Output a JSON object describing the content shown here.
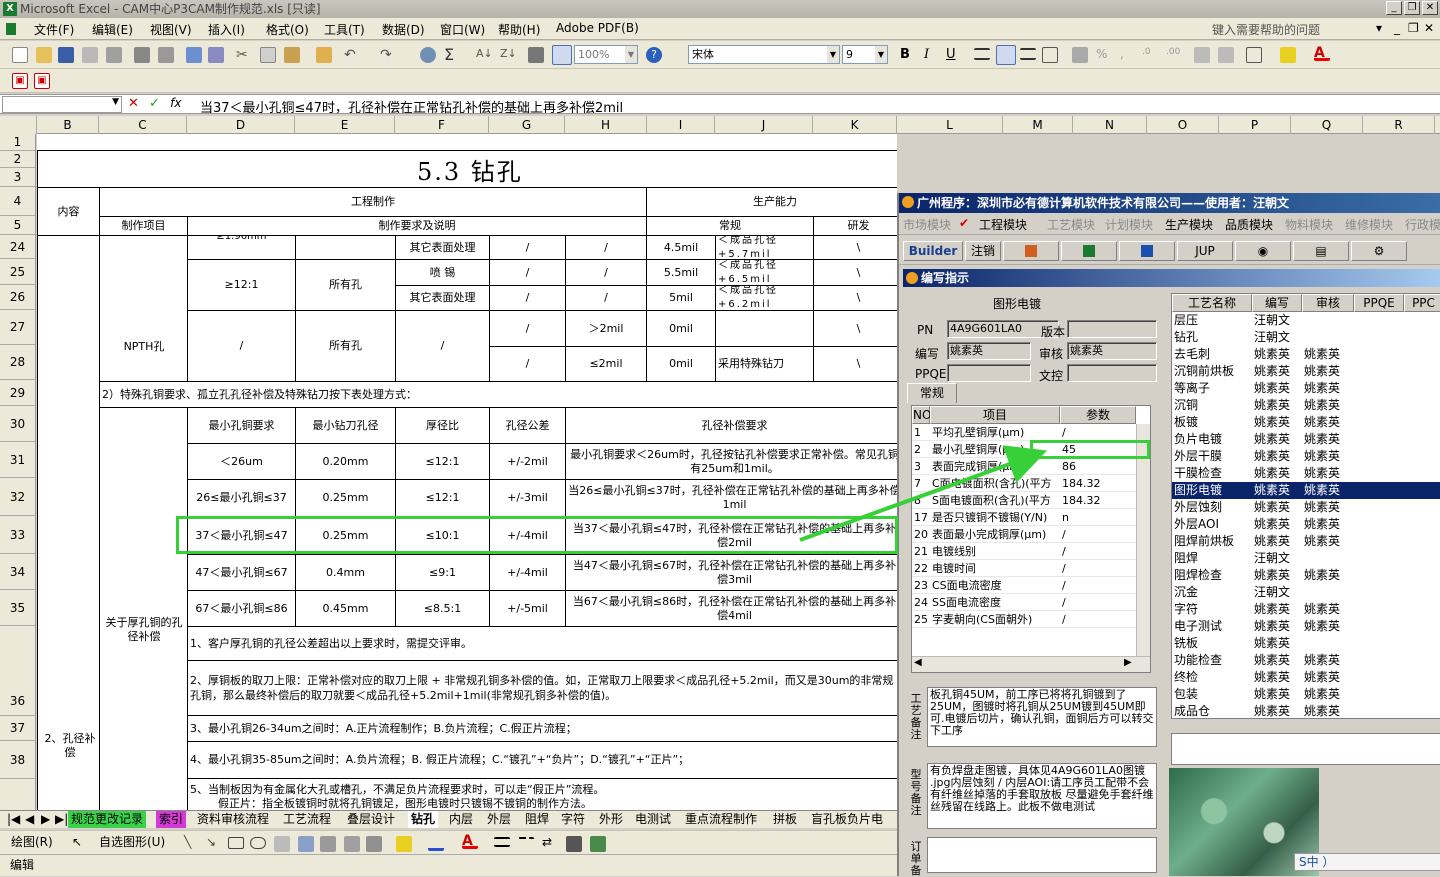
{
  "window": {
    "app_title": "Microsoft Excel - CAM中心P3CAM制作规范.xls [只读]",
    "icon": "excel-icon",
    "help_box": "键入需要帮助的问题"
  },
  "menu": [
    "文件(F)",
    "编辑(E)",
    "视图(V)",
    "插入(I)",
    "格式(O)",
    "工具(T)",
    "数据(D)",
    "窗口(W)",
    "帮助(H)",
    "Adobe PDF(B)"
  ],
  "toolbar": {
    "zoom": "100%",
    "font_name": "宋体",
    "font_size": "9",
    "bold": "B",
    "italic": "I",
    "underline": "U"
  },
  "formula_bar": {
    "name_box": "",
    "fx": "fx",
    "content": "当37＜最小孔铜≤47时，孔径补偿在正常钻孔补偿的基础上再多补偿2mil"
  },
  "columns": [
    "B",
    "C",
    "D",
    "E",
    "F",
    "G",
    "H",
    "I",
    "J",
    "K",
    "L",
    "M",
    "N",
    "O",
    "P",
    "Q",
    "R"
  ],
  "rows": [
    "1",
    "2",
    "3",
    "4",
    "5",
    "24",
    "25",
    "26",
    "27",
    "28",
    "29",
    "30",
    "31",
    "32",
    "33",
    "34",
    "35",
    "36",
    "37",
    "38"
  ],
  "sheet": {
    "title": "5.3 钻孔",
    "header": {
      "content": "内容",
      "engineering": "工程制作",
      "capability": "生产能力",
      "item": "制作项目",
      "requirement": "制作要求及说明",
      "normal": "常规",
      "rnd": "研发"
    },
    "top_rows": [
      {
        "ratio": "",
        "finish": "其它表面处理",
        "g": "/",
        "h": "/",
        "normal": "4.5mil",
        "req": "＜成品孔径+5.7mil",
        "rnd": "\\"
      },
      {
        "ratio": "≥12:1",
        "hole": "所有孔",
        "finish": "喷 锡",
        "g": "/",
        "h": "/",
        "normal": "5.5mil",
        "req": "＜成品孔径+6.5mil",
        "rnd": "\\"
      },
      {
        "finish": "其它表面处理",
        "g": "/",
        "h": "/",
        "normal": "5mil",
        "req": "＜成品孔径+6.2mil",
        "rnd": "\\"
      }
    ],
    "top_partial": "≥1.96mm",
    "npth": {
      "label": "NPTH孔",
      "d": "/",
      "e": "所有孔",
      "f": "/",
      "row1": {
        "g": "/",
        "h": "＞2mil",
        "normal": "0mil",
        "req": "",
        "rnd": "\\"
      },
      "row2": {
        "g": "/",
        "h": "≤2mil",
        "normal": "0mil",
        "req": "采用特殊钻刀",
        "rnd": "\\"
      }
    },
    "special_note": "2）特殊孔铜要求、孤立孔孔径补偿及特殊钻刀按下表处理方式：",
    "thick_copper_label": "关于厚孔铜的孔径补偿",
    "hole_comp_label": "2、孔径补偿",
    "comp_table": {
      "headers": [
        "最小孔铜要求",
        "最小钻刀孔径",
        "厚径比",
        "孔径公差",
        "孔径补偿要求"
      ],
      "rows": [
        [
          "＜26um",
          "0.20mm",
          "≤12:1",
          "+/-2mil",
          "最小孔铜要求＜26um时，孔径按钻孔补偿要求正常补偿。常见孔铜有25um和1mil。"
        ],
        [
          "26≤最小孔铜≤37",
          "0.25mm",
          "≤12:1",
          "+/-3mil",
          "当26≤最小孔铜≤37时，孔径补偿在正常钻孔补偿的基础上再多补偿1mil"
        ],
        [
          "37＜最小孔铜≤47",
          "0.25mm",
          "≤10:1",
          "+/-4mil",
          "当37＜最小孔铜≤47时，孔径补偿在正常钻孔补偿的基础上再多补偿2mil"
        ],
        [
          "47＜最小孔铜≤67",
          "0.4mm",
          "≤9:1",
          "+/-4mil",
          "当47＜最小孔铜≤67时，孔径补偿在正常钻孔补偿的基础上再多补偿3mil"
        ],
        [
          "67＜最小孔铜≤86",
          "0.45mm",
          "≤8.5:1",
          "+/-5mil",
          "当67＜最小孔铜≤86时，孔径补偿在正常钻孔补偿的基础上再多补偿4mil"
        ]
      ]
    },
    "notes": [
      "1、客户厚孔铜的孔径公差超出以上要求时，需提交评审。",
      "2、厚铜板的取刀上限：正常补偿对应的取刀上限 + 非常规孔铜多补偿的值。如，正常取刀上限要求＜成品孔径+5.2mil，而又是30um的非常规孔铜，那么最终补偿后的取刀就要＜成品孔径+5.2mil+1mil(非常规孔铜多补偿的值)。",
      "3、最小孔铜26-34um之间时：A.正片流程制作；B.负片流程；C.假正片流程；",
      "4、最小孔铜35-85um之间时：A.负片流程；B. 假正片流程；C.“镀孔”+“负片”；D.“镀孔”+“正片”；",
      "5、当制板因为有金属化大孔或槽孔，不满足负片流程要求时，可以走“假正片”流程。",
      "假正片：指全板镀铜时就将孔铜镀足，图形电镀时只镀锡不镀铜的制作方法。"
    ]
  },
  "sheet_tabs": [
    "规范更改记录",
    "索引",
    "资料审核流程",
    "工艺流程",
    "叠层设计",
    "钻孔",
    "内层",
    "外层",
    "阻焊",
    "字符",
    "外形",
    "电测试",
    "重点流程制作",
    "拼板",
    "盲孔板负片电"
  ],
  "draw_toolbar": {
    "draw": "绘图(R)",
    "autoshape": "自选图形(U)"
  },
  "status": "编辑",
  "panel": {
    "title": "广州程序：深圳市必有德计算机软件技术有限公司——使用者：汪朝文",
    "modules": [
      {
        "label": "市场模块",
        "active": false
      },
      {
        "label": "工程模块",
        "active": true
      },
      {
        "label": "工艺模块",
        "active": false
      },
      {
        "label": "计划模块",
        "active": false
      },
      {
        "label": "生产模块",
        "active": true
      },
      {
        "label": "品质模块",
        "active": true
      },
      {
        "label": "物料模块",
        "active": false
      },
      {
        "label": "维修模块",
        "active": false
      },
      {
        "label": "行政模",
        "active": false
      }
    ],
    "tools": {
      "builder": "Builder",
      "logout": "注销",
      "jup": "JUP"
    },
    "dialog_title": "编写指示",
    "section": "图形电镀",
    "fields": {
      "pn_label": "PN",
      "pn": "4A9G601LA0",
      "version_label": "版本",
      "version": "",
      "writer_label": "编写",
      "writer": "姚素英",
      "review_label": "审核",
      "review": "姚素英",
      "ppqe_label": "PPQE",
      "ppqe": "",
      "control_label": "文控",
      "control": ""
    },
    "tab": "常规",
    "param_headers": {
      "no": "NO",
      "item": "项目",
      "value": "参数"
    },
    "params": [
      {
        "no": "1",
        "item": "平均孔壁铜厚(μm)",
        "value": "/"
      },
      {
        "no": "2",
        "item": "最小孔壁铜厚(μm)",
        "value": "45"
      },
      {
        "no": "3",
        "item": "表面完成铜厚(μm)",
        "value": "86"
      },
      {
        "no": "7",
        "item": "C面电镀面积(含孔)(平方",
        "value": "184.32"
      },
      {
        "no": "8",
        "item": "S面电镀面积(含孔)(平方",
        "value": "184.32"
      },
      {
        "no": "17",
        "item": "是否只镀铜不镀锡(Y/N)",
        "value": "n"
      },
      {
        "no": "20",
        "item": "表面最小完成铜厚(μm)",
        "value": "/"
      },
      {
        "no": "21",
        "item": "电镀线别",
        "value": "/"
      },
      {
        "no": "22",
        "item": "电镀时间",
        "value": "/"
      },
      {
        "no": "23",
        "item": "CS面电流密度",
        "value": "/"
      },
      {
        "no": "24",
        "item": "SS面电流密度",
        "value": "/"
      },
      {
        "no": "25",
        "item": "字麦朝向(CS面朝外)",
        "value": "/"
      }
    ],
    "process_headers": {
      "name": "工艺名称",
      "writer": "编写",
      "review": "审核",
      "ppqe": "PPQE",
      "ppc": "PPC"
    },
    "processes": [
      {
        "name": "层压",
        "writer": "汪朝文",
        "review": ""
      },
      {
        "name": "钻孔",
        "writer": "汪朝文",
        "review": ""
      },
      {
        "name": "去毛刺",
        "writer": "姚素英",
        "review": "姚素英"
      },
      {
        "name": "沉铜前烘板",
        "writer": "姚素英",
        "review": "姚素英"
      },
      {
        "name": "等离子",
        "writer": "姚素英",
        "review": "姚素英"
      },
      {
        "name": "沉铜",
        "writer": "姚素英",
        "review": "姚素英"
      },
      {
        "name": "板镀",
        "writer": "姚素英",
        "review": "姚素英"
      },
      {
        "name": "负片电镀",
        "writer": "姚素英",
        "review": "姚素英"
      },
      {
        "name": "外层干膜",
        "writer": "姚素英",
        "review": "姚素英"
      },
      {
        "name": "干膜检查",
        "writer": "姚素英",
        "review": "姚素英"
      },
      {
        "name": "图形电镀",
        "writer": "姚素英",
        "review": "姚素英",
        "selected": true
      },
      {
        "name": "外层蚀刻",
        "writer": "姚素英",
        "review": "姚素英"
      },
      {
        "name": "外层AOI",
        "writer": "姚素英",
        "review": "姚素英"
      },
      {
        "name": "阻焊前烘板",
        "writer": "姚素英",
        "review": "姚素英"
      },
      {
        "name": "阻焊",
        "writer": "汪朝文",
        "review": ""
      },
      {
        "name": "阻焊检查",
        "writer": "姚素英",
        "review": "姚素英"
      },
      {
        "name": "沉金",
        "writer": "汪朝文",
        "review": ""
      },
      {
        "name": "字符",
        "writer": "姚素英",
        "review": "姚素英"
      },
      {
        "name": "电子测试",
        "writer": "姚素英",
        "review": "姚素英"
      },
      {
        "name": "铣板",
        "writer": "姚素英",
        "review": ""
      },
      {
        "name": "功能检查",
        "writer": "姚素英",
        "review": "姚素英"
      },
      {
        "name": "终检",
        "writer": "姚素英",
        "review": "姚素英"
      },
      {
        "name": "包装",
        "writer": "姚素英",
        "review": "姚素英"
      },
      {
        "name": "成品仓",
        "writer": "姚素英",
        "review": "姚素英"
      }
    ],
    "process_note_label": "工艺备注",
    "process_note": "板孔铜45UM，前工序已将将孔铜镀到了25UM，图镀时将孔铜从25UM镀到45UM即可.电镀后切片，确认孔铜，面铜后方可以转交下工序",
    "type_note_label": "型号备注",
    "type_note": "有负焊盘走图镀，具体见4A9G601LA0图镀 .jpg内层蚀刻 / 内层AOI:请工序员工配带不会有纤维丝掉落的手套取放板 尽量避免手套纤维丝残留在线路上。此板不做电测试",
    "order_note_label": "订单备",
    "ime": "S中 ）"
  },
  "colors": {
    "highlight": "#38d038",
    "selection": "#0a246a",
    "title_blue": "#0a246a",
    "active_tab": "#39d34a",
    "index_tab": "#d63ad6"
  }
}
